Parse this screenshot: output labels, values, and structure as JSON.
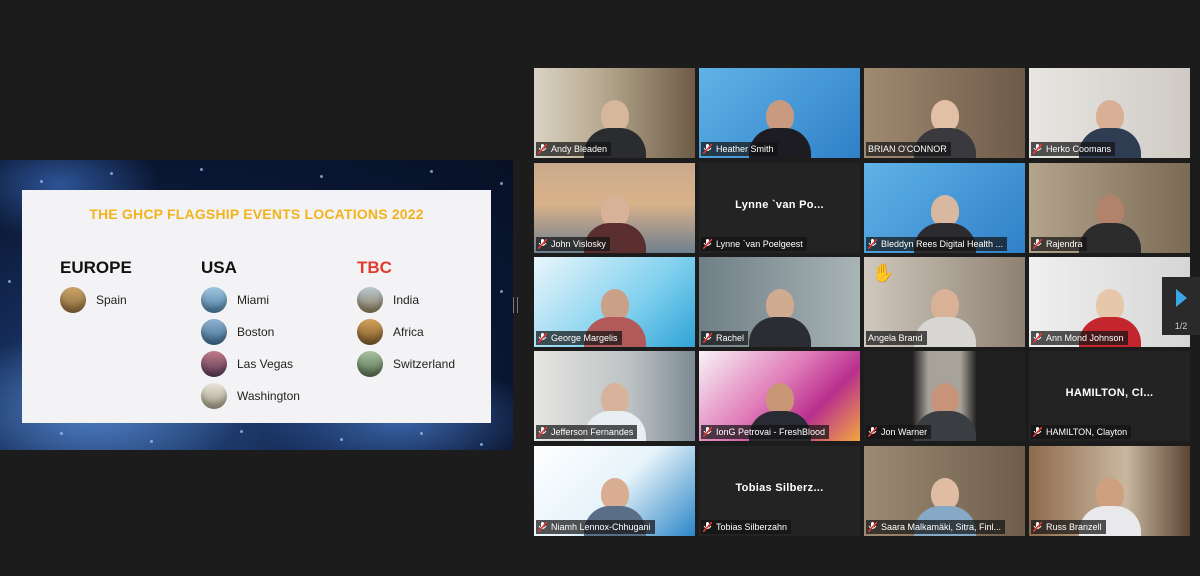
{
  "slide": {
    "title": "THE GHCP FLAGSHIP EVENTS LOCATIONS 2022",
    "columns": [
      {
        "heading": "EUROPE",
        "items": [
          "Spain"
        ]
      },
      {
        "heading": "USA",
        "items": [
          "Miami",
          "Boston",
          "Las Vegas",
          "Washington"
        ]
      },
      {
        "heading": "TBC",
        "items": [
          "India",
          "Africa",
          "Switzerland"
        ]
      }
    ],
    "heading_colors": {
      "default": "#111111",
      "tbc": "#e23b2e"
    },
    "title_color": "#f2b31d"
  },
  "participants": [
    {
      "name": "Andy Bleaden"
    },
    {
      "name": "Heather Smith"
    },
    {
      "name": "BRIAN O'CONNOR"
    },
    {
      "name": "Herko Coomans"
    },
    {
      "name": "John Vislosky"
    },
    {
      "name": "Lynne `van Poelgeest",
      "center_text": "Lynne `van Po..."
    },
    {
      "name": "Bleddyn Rees Digital Health ..."
    },
    {
      "name": "Rajendra"
    },
    {
      "name": "George Margelis"
    },
    {
      "name": "Rachel"
    },
    {
      "name": "Angela Brand"
    },
    {
      "name": "Ann Mond Johnson"
    },
    {
      "name": "Jefferson Fernandes"
    },
    {
      "name": "IonG Petrovai - FreshBlood"
    },
    {
      "name": "Jon Warner"
    },
    {
      "name": "HAMILTON, Clayton",
      "center_text": "HAMILTON, Cl..."
    },
    {
      "name": "Niamh Lennox-Chhugani"
    },
    {
      "name": "Tobias Silberzahn",
      "center_text": "Tobias Silberz..."
    },
    {
      "name": "Saara Malkamäki, Sitra, Finl..."
    },
    {
      "name": "Russ Branzell"
    }
  ],
  "pager": {
    "page_label": "1/2",
    "icon": "next-page-arrow-icon"
  },
  "colors": {
    "active_speaker": "#35c44b",
    "muted_mic": "#e03a3a"
  }
}
